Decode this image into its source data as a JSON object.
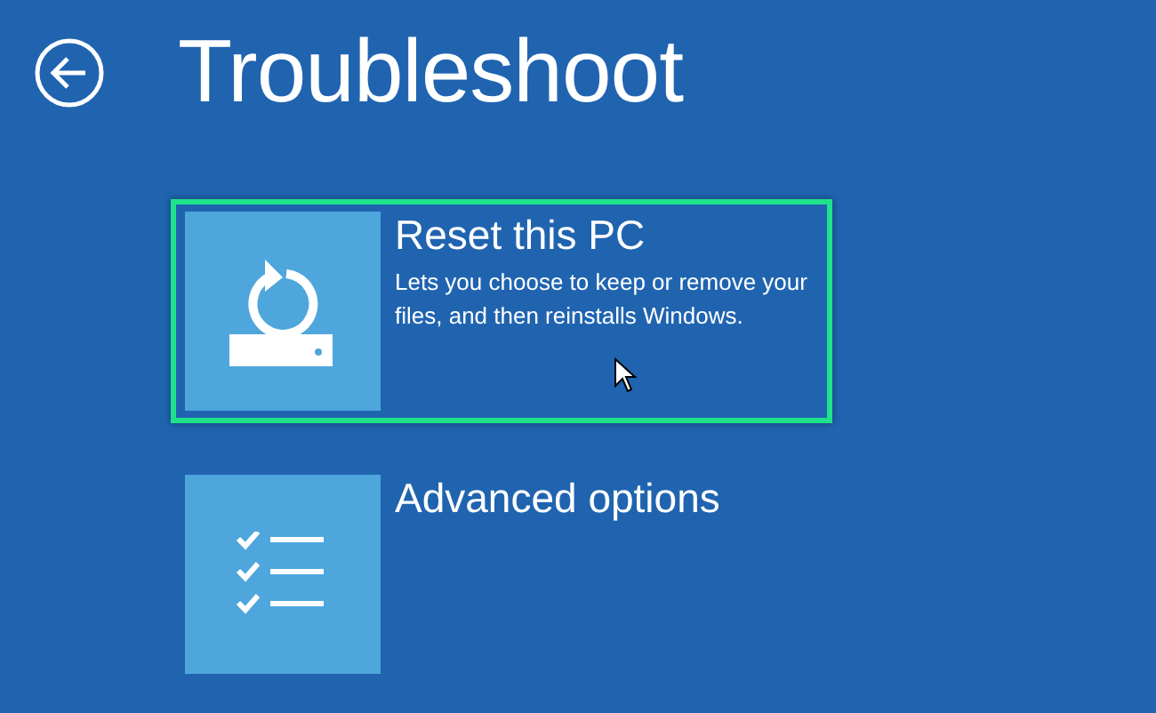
{
  "title": "Troubleshoot",
  "options": [
    {
      "kind": "reset",
      "label": "Reset this PC",
      "description": "Lets you choose to keep or remove your files, and then reinstalls Windows.",
      "selected": true
    },
    {
      "kind": "advanced",
      "label": "Advanced options",
      "selected": false
    }
  ]
}
